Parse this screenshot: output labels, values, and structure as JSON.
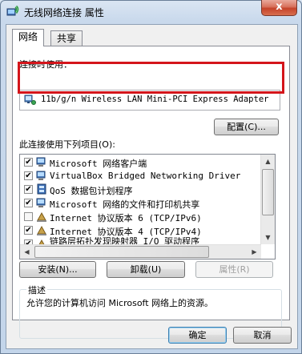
{
  "window": {
    "title": "无线网络连接 属性",
    "close_label": "x"
  },
  "tabs": [
    {
      "label": "网络",
      "active": true
    },
    {
      "label": "共享",
      "active": false
    }
  ],
  "connect_using_label": "连接时使用：",
  "adapter_name": "11b/g/n  Wireless LAN Mini-PCI Express Adapter",
  "configure_button": "配置(C)...",
  "items_label": "此连接使用下列项目(O):",
  "items": [
    {
      "label": "Microsoft 网络客户端",
      "checked": true,
      "icon": "network-client-icon"
    },
    {
      "label": "VirtualBox Bridged Networking Driver",
      "checked": true,
      "icon": "network-driver-icon"
    },
    {
      "label": "QoS 数据包计划程序",
      "checked": true,
      "icon": "qos-icon"
    },
    {
      "label": "Microsoft 网络的文件和打印机共享",
      "checked": true,
      "icon": "file-sharing-icon"
    },
    {
      "label": "Internet 协议版本 6 (TCP/IPv6)",
      "checked": false,
      "icon": "protocol-icon"
    },
    {
      "label": "Internet 协议版本 4 (TCP/IPv4)",
      "checked": true,
      "icon": "protocol-icon"
    },
    {
      "label": "链路层拓扑发现映射器 I/O 驱动程序",
      "checked": true,
      "icon": "protocol-icon"
    }
  ],
  "buttons": {
    "install": "安装(N)...",
    "uninstall": "卸载(U)",
    "properties": "属性(R)"
  },
  "description": {
    "legend": "描述",
    "text": "允许您的计算机访问 Microsoft 网络上的资源。"
  },
  "footer": {
    "ok": "确定",
    "cancel": "取消"
  }
}
